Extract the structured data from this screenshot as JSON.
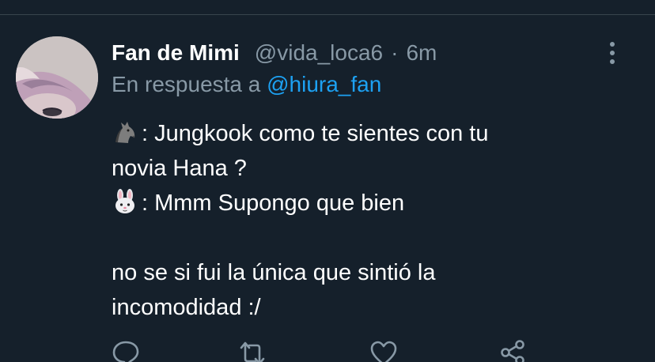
{
  "tweet": {
    "display_name": "Fan de Mimi",
    "handle": "@vida_loca6",
    "separator": "·",
    "time": "6m",
    "reply_prefix": "En respuesta a",
    "reply_to": "@hiura_fan",
    "lines": [
      ": Jungkook como te sientes con tu",
      "novia Hana ?",
      ": Mmm Supongo que bien",
      "",
      "no se si fui la única que sintió la",
      "incomodidad :/"
    ],
    "line_icons": [
      "horse-emoji",
      "rabbit-emoji"
    ]
  },
  "actions": [
    "reply-icon",
    "retweet-icon",
    "like-icon",
    "share-icon"
  ],
  "colors": {
    "background": "#15202b",
    "text": "#ffffff",
    "secondary": "#8899a6",
    "link": "#1da1f2",
    "divider": "#38444d"
  }
}
